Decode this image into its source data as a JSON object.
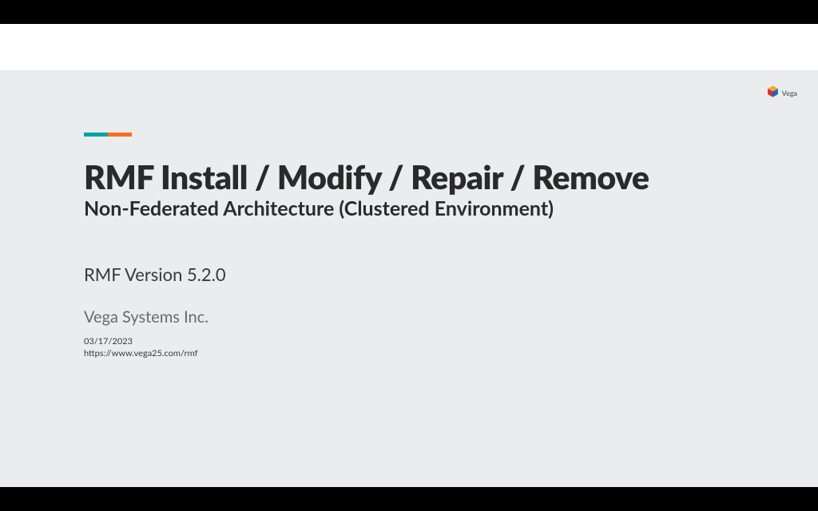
{
  "logo": {
    "name": "Vega"
  },
  "slide": {
    "title": "RMF Install / Modify / Repair / Remove",
    "subtitle": "Non-Federated Architecture (Clustered Environment)",
    "version": "RMF Version 5.2.0",
    "company": "Vega Systems Inc.",
    "date": "03/17/2023",
    "url": "https://www.vega25.com/rmf"
  },
  "colors": {
    "teal": "#00a3a3",
    "orange": "#f37021"
  }
}
